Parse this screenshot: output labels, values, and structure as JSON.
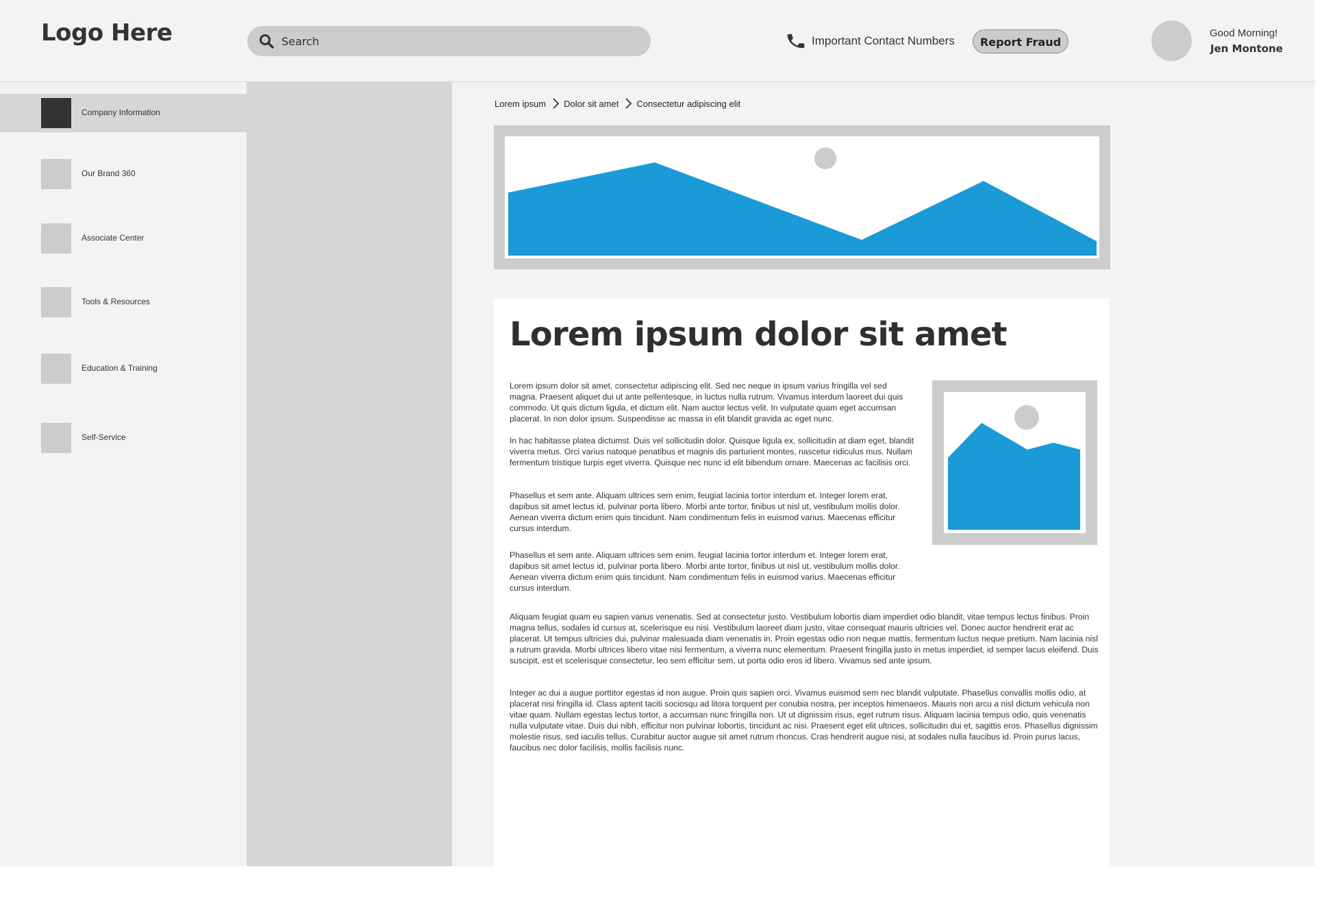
{
  "header": {
    "logo": "Logo Here",
    "search_placeholder": "Search",
    "contact_label": "Important Contact Numbers",
    "report_button": "Report Fraud",
    "greeting": "Good Morning!",
    "user_name": "Jen Montone"
  },
  "sidebar": {
    "items": [
      {
        "label": "Company Information",
        "active": true
      },
      {
        "label": "Our Brand 360"
      },
      {
        "label": "Associate Center"
      },
      {
        "label": "Tools & Resources"
      },
      {
        "label": "Education & Training"
      },
      {
        "label": "Self-Service"
      }
    ]
  },
  "breadcrumb": [
    "Lorem ipsum",
    "Dolor sit amet",
    "Consectetur adipiscing elit"
  ],
  "article": {
    "title": "Lorem ipsum dolor sit amet",
    "paragraphs": [
      "Lorem ipsum dolor sit amet, consectetur adipiscing elit. Sed nec neque in ipsum varius fringilla vel sed magna. Praesent aliquet dui ut ante pellentesque, in luctus nulla rutrum. Vivamus interdum laoreet dui quis commodo. Ut quis dictum ligula, et dictum elit. Nam auctor lectus velit. In vulputate quam eget accumsan placerat. In non dolor ipsum. Suspendisse ac massa in elit blandit gravida ac eget nunc.",
      "In hac habitasse platea dictumst. Duis vel sollicitudin dolor. Quisque ligula ex, sollicitudin at diam eget, blandit viverra metus. Orci varius natoque penatibus et magnis dis parturient montes, nascetur ridiculus mus. Nullam fermentum tristique turpis eget viverra. Quisque nec nunc id elit bibendum ornare. Maecenas ac facilisis orci.",
      "Phasellus et sem ante. Aliquam ultrices sem enim, feugiat lacinia tortor interdum et. Integer lorem erat, dapibus sit amet lectus id, pulvinar porta libero. Morbi ante tortor, finibus ut nisl ut, vestibulum mollis dolor. Aenean viverra dictum enim quis tincidunt. Nam condimentum felis in euismod varius. Maecenas efficitur cursus interdum.",
      "Phasellus et sem ante. Aliquam ultrices sem enim, feugiat lacinia tortor interdum et. Integer lorem erat, dapibus sit amet lectus id, pulvinar porta libero. Morbi ante tortor, finibus ut nisl ut, vestibulum mollis dolor. Aenean viverra dictum enim quis tincidunt. Nam condimentum felis in euismod varius. Maecenas efficitur cursus interdum.",
      "Aliquam feugiat quam eu sapien varius venenatis. Sed at consectetur justo. Vestibulum lobortis diam imperdiet odio blandit, vitae tempus lectus finibus. Proin magna tellus, sodales id cursus at, scelerisque eu nisi. Vestibulum laoreet diam justo, vitae consequat mauris ultricies vel. Donec auctor hendrerit erat ac placerat. Ut tempus ultricies dui, pulvinar malesuada diam venenatis in. Proin egestas odio non neque mattis, fermentum luctus neque pretium. Nam lacinia nisl a rutrum gravida. Morbi ultrices libero vitae nisi fermentum, a viverra nunc elementum. Praesent fringilla justo in metus imperdiet, id semper lacus eleifend. Duis suscipit, est et scelerisque consectetur, leo sem efficitur sem, ut porta odio eros id libero. Vivamus sed ante ipsum.",
      "Integer ac dui a augue porttitor egestas id non augue. Proin quis sapien orci. Vivamus euismod sem nec blandit vulputate. Phasellus convallis mollis odio, at placerat nisi fringilla id. Class aptent taciti sociosqu ad litora torquent per conubia nostra, per inceptos himenaeos. Mauris non arcu a nisl dictum vehicula non vitae quam. Nullam egestas lectus tortor, a accumsan nunc fringilla non. Ut ut dignissim risus, eget rutrum risus. Aliquam lacinia tempus odio, quis venenatis nulla vulputate vitae. Duis dui nibh, efficitur non pulvinar lobortis, tincidunt ac nisi. Praesent eget elit ultrices, sollicitudin dui et, sagittis eros. Phasellus dignissim molestie risus, sed iaculis tellus. Curabitur auctor augue sit amet rutrum rhoncus. Cras hendrerit augue nisi, at sodales nulla faucibus id. Proin purus lacus, faucibus nec dolor facilisis, mollis facilisis nunc."
    ]
  },
  "colors": {
    "accent_blue": "#1a9bd7",
    "placeholder_gray": "#cccccc",
    "panel_gray": "#d6d6d7",
    "page_bg": "#f4f3f4",
    "active_icon": "#333333"
  },
  "icons": {
    "search": "search-icon",
    "phone": "phone-icon",
    "breadcrumb_separator": "chevron-right-icon",
    "image_placeholder": "image-placeholder-icon"
  }
}
